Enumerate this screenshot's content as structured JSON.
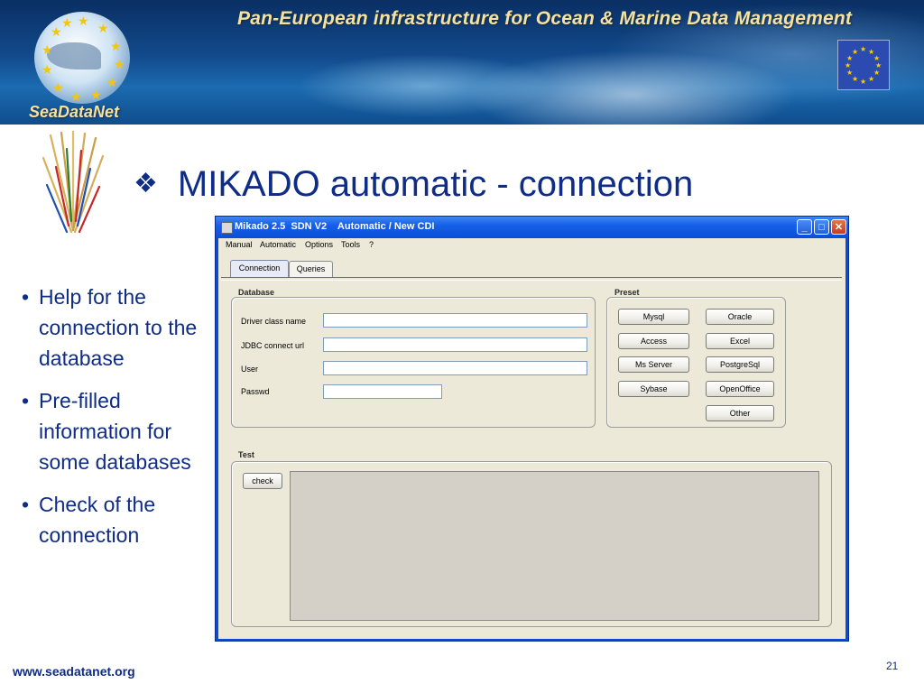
{
  "banner": {
    "title": "Pan-European infrastructure for Ocean & Marine Data Management",
    "logo_text": "SeaDataNet",
    "logo_icon": "seadatanet-logo",
    "flag_icon": "eu-flag-icon"
  },
  "slide": {
    "bullet_symbol": "❖",
    "title": "MIKADO automatic - connection",
    "bullets": [
      "Help for the connection to the database",
      "Pre-filled information for some databases",
      "Check of the connection"
    ],
    "footer_url": "www.seadatanet.org",
    "page_number": "21"
  },
  "window": {
    "title": "Mikado 2.5  SDN V2    Automatic / New CDI",
    "menu": [
      "Manual",
      "Automatic",
      "Options",
      "Tools",
      "?"
    ],
    "tabs": [
      "Connection",
      "Queries"
    ],
    "active_tab": "Connection",
    "database": {
      "label": "Database",
      "fields": [
        {
          "label": "Driver class name",
          "value": ""
        },
        {
          "label": "JDBC connect url",
          "value": ""
        },
        {
          "label": "User",
          "value": ""
        },
        {
          "label": "Passwd",
          "value": ""
        }
      ]
    },
    "preset": {
      "label": "Preset",
      "buttons": [
        "Mysql",
        "Oracle",
        "Access",
        "Excel",
        "Ms Server",
        "PostgreSql",
        "Sybase",
        "OpenOffice",
        "Other"
      ]
    },
    "test": {
      "label": "Test",
      "check_button": "check",
      "output": ""
    }
  },
  "colors": {
    "title_blue": "#0f2c86",
    "xp_titlebar": "#0a4ed8",
    "window_bg": "#ece9d8",
    "banner_text": "#f3e2a0"
  }
}
